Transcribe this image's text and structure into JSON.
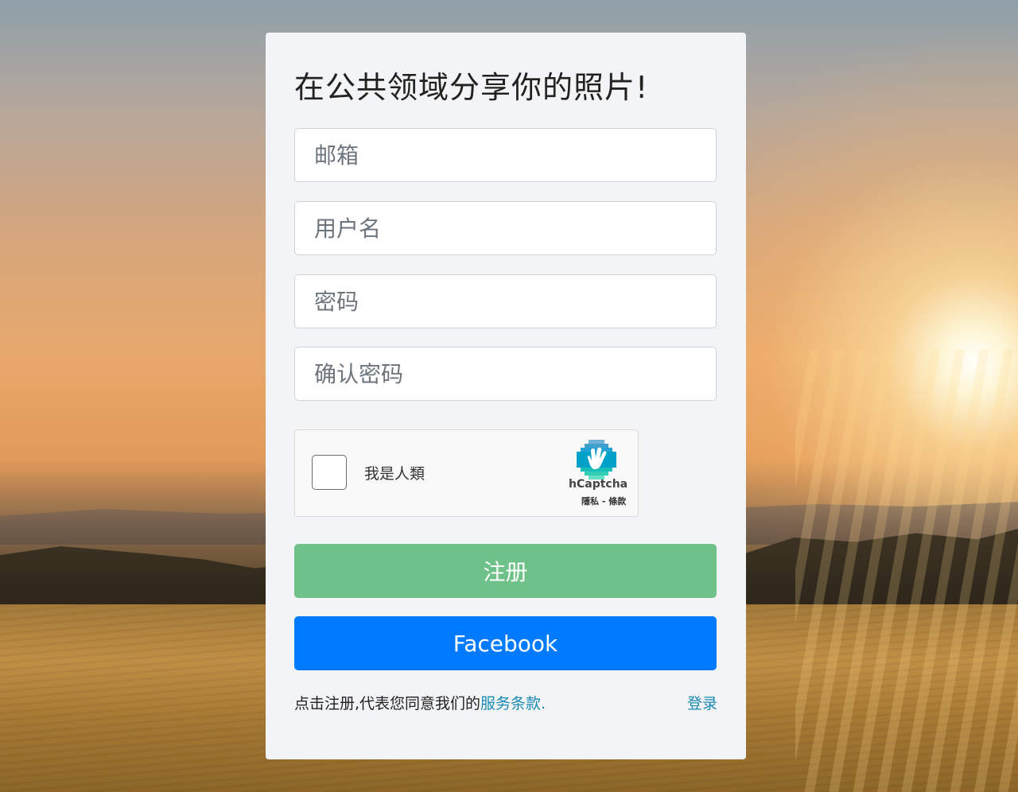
{
  "form": {
    "title": "在公共领域分享你的照片!",
    "email_placeholder": "邮箱",
    "username_placeholder": "用户名",
    "password_placeholder": "密码",
    "confirm_password_placeholder": "确认密码",
    "register_label": "注册",
    "facebook_label": "Facebook",
    "terms_prefix": "点击注册,代表您同意我们的",
    "terms_link": "服务条款.",
    "login_link": "登录"
  },
  "captcha": {
    "label": "我是人類",
    "brand": "hCaptcha",
    "links": "隱私 - 條款",
    "logo_icon": "hcaptcha-hand-icon"
  },
  "colors": {
    "register_button": "#6ec289",
    "facebook_button": "#007bff",
    "link": "#1a8ab3",
    "card_bg": "#f3f4f6"
  }
}
